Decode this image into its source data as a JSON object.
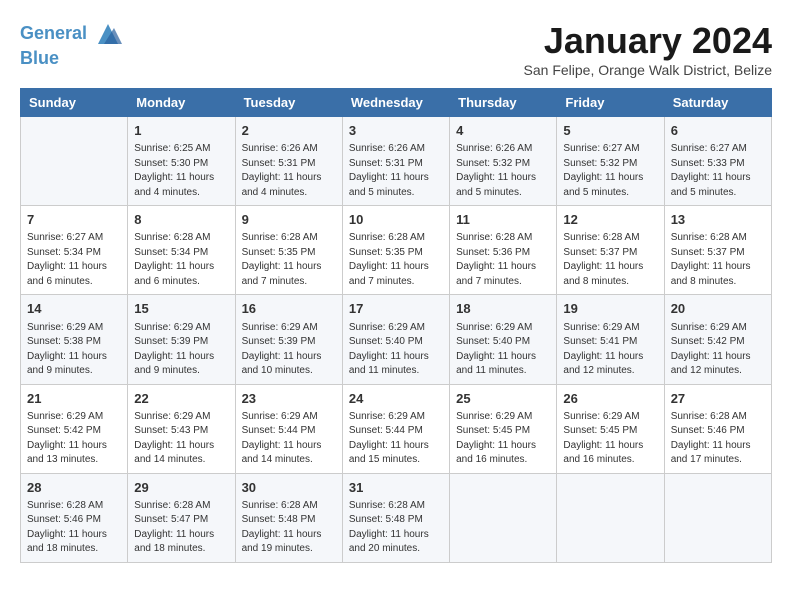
{
  "logo": {
    "line1": "General",
    "line2": "Blue"
  },
  "title": "January 2024",
  "subtitle": "San Felipe, Orange Walk District, Belize",
  "days_of_week": [
    "Sunday",
    "Monday",
    "Tuesday",
    "Wednesday",
    "Thursday",
    "Friday",
    "Saturday"
  ],
  "weeks": [
    [
      {
        "day": "",
        "sunrise": "",
        "sunset": "",
        "daylight": ""
      },
      {
        "day": "1",
        "sunrise": "6:25 AM",
        "sunset": "5:30 PM",
        "daylight": "11 hours and 4 minutes."
      },
      {
        "day": "2",
        "sunrise": "6:26 AM",
        "sunset": "5:31 PM",
        "daylight": "11 hours and 4 minutes."
      },
      {
        "day": "3",
        "sunrise": "6:26 AM",
        "sunset": "5:31 PM",
        "daylight": "11 hours and 5 minutes."
      },
      {
        "day": "4",
        "sunrise": "6:26 AM",
        "sunset": "5:32 PM",
        "daylight": "11 hours and 5 minutes."
      },
      {
        "day": "5",
        "sunrise": "6:27 AM",
        "sunset": "5:32 PM",
        "daylight": "11 hours and 5 minutes."
      },
      {
        "day": "6",
        "sunrise": "6:27 AM",
        "sunset": "5:33 PM",
        "daylight": "11 hours and 5 minutes."
      }
    ],
    [
      {
        "day": "7",
        "sunrise": "6:27 AM",
        "sunset": "5:34 PM",
        "daylight": "11 hours and 6 minutes."
      },
      {
        "day": "8",
        "sunrise": "6:28 AM",
        "sunset": "5:34 PM",
        "daylight": "11 hours and 6 minutes."
      },
      {
        "day": "9",
        "sunrise": "6:28 AM",
        "sunset": "5:35 PM",
        "daylight": "11 hours and 7 minutes."
      },
      {
        "day": "10",
        "sunrise": "6:28 AM",
        "sunset": "5:35 PM",
        "daylight": "11 hours and 7 minutes."
      },
      {
        "day": "11",
        "sunrise": "6:28 AM",
        "sunset": "5:36 PM",
        "daylight": "11 hours and 7 minutes."
      },
      {
        "day": "12",
        "sunrise": "6:28 AM",
        "sunset": "5:37 PM",
        "daylight": "11 hours and 8 minutes."
      },
      {
        "day": "13",
        "sunrise": "6:28 AM",
        "sunset": "5:37 PM",
        "daylight": "11 hours and 8 minutes."
      }
    ],
    [
      {
        "day": "14",
        "sunrise": "6:29 AM",
        "sunset": "5:38 PM",
        "daylight": "11 hours and 9 minutes."
      },
      {
        "day": "15",
        "sunrise": "6:29 AM",
        "sunset": "5:39 PM",
        "daylight": "11 hours and 9 minutes."
      },
      {
        "day": "16",
        "sunrise": "6:29 AM",
        "sunset": "5:39 PM",
        "daylight": "11 hours and 10 minutes."
      },
      {
        "day": "17",
        "sunrise": "6:29 AM",
        "sunset": "5:40 PM",
        "daylight": "11 hours and 11 minutes."
      },
      {
        "day": "18",
        "sunrise": "6:29 AM",
        "sunset": "5:40 PM",
        "daylight": "11 hours and 11 minutes."
      },
      {
        "day": "19",
        "sunrise": "6:29 AM",
        "sunset": "5:41 PM",
        "daylight": "11 hours and 12 minutes."
      },
      {
        "day": "20",
        "sunrise": "6:29 AM",
        "sunset": "5:42 PM",
        "daylight": "11 hours and 12 minutes."
      }
    ],
    [
      {
        "day": "21",
        "sunrise": "6:29 AM",
        "sunset": "5:42 PM",
        "daylight": "11 hours and 13 minutes."
      },
      {
        "day": "22",
        "sunrise": "6:29 AM",
        "sunset": "5:43 PM",
        "daylight": "11 hours and 14 minutes."
      },
      {
        "day": "23",
        "sunrise": "6:29 AM",
        "sunset": "5:44 PM",
        "daylight": "11 hours and 14 minutes."
      },
      {
        "day": "24",
        "sunrise": "6:29 AM",
        "sunset": "5:44 PM",
        "daylight": "11 hours and 15 minutes."
      },
      {
        "day": "25",
        "sunrise": "6:29 AM",
        "sunset": "5:45 PM",
        "daylight": "11 hours and 16 minutes."
      },
      {
        "day": "26",
        "sunrise": "6:29 AM",
        "sunset": "5:45 PM",
        "daylight": "11 hours and 16 minutes."
      },
      {
        "day": "27",
        "sunrise": "6:28 AM",
        "sunset": "5:46 PM",
        "daylight": "11 hours and 17 minutes."
      }
    ],
    [
      {
        "day": "28",
        "sunrise": "6:28 AM",
        "sunset": "5:46 PM",
        "daylight": "11 hours and 18 minutes."
      },
      {
        "day": "29",
        "sunrise": "6:28 AM",
        "sunset": "5:47 PM",
        "daylight": "11 hours and 18 minutes."
      },
      {
        "day": "30",
        "sunrise": "6:28 AM",
        "sunset": "5:48 PM",
        "daylight": "11 hours and 19 minutes."
      },
      {
        "day": "31",
        "sunrise": "6:28 AM",
        "sunset": "5:48 PM",
        "daylight": "11 hours and 20 minutes."
      },
      {
        "day": "",
        "sunrise": "",
        "sunset": "",
        "daylight": ""
      },
      {
        "day": "",
        "sunrise": "",
        "sunset": "",
        "daylight": ""
      },
      {
        "day": "",
        "sunrise": "",
        "sunset": "",
        "daylight": ""
      }
    ]
  ]
}
